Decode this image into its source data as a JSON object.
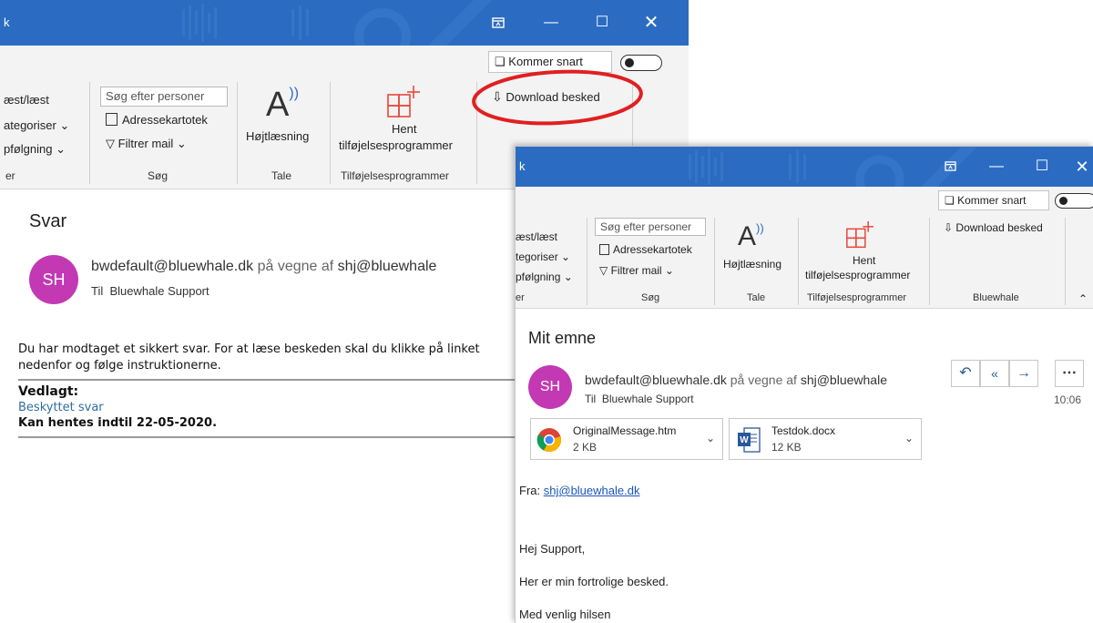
{
  "window1": {
    "title": "k",
    "coming_soon_label": "Kommer snart",
    "download_label": "Download besked",
    "ribbon": {
      "read_unread": "æst/læst",
      "categorize": "ategoriser",
      "followup": "pfølgning",
      "group_partial": "er",
      "search_placeholder": "Søg efter personer",
      "address_book": "Adressekartotek",
      "filter_mail": "Filtrer mail",
      "group_search": "Søg",
      "read_aloud": "Højtlæsning",
      "group_speech": "Tale",
      "get_addins_line1": "Hent",
      "get_addins_line2": "tilføjelsesprogrammer",
      "group_addins": "Tilføjelsesprogrammer"
    },
    "message": {
      "subject": "Svar",
      "avatar_initials": "SH",
      "sender": "bwdefault@bluewhale.dk",
      "on_behalf_word": "på vegne af",
      "on_behalf_of": "shj@bluewhale",
      "to_label": "Til",
      "to_value": "Bluewhale Support",
      "body_line1": "Du har modtaget et sikkert svar. For at læse beskeden skal du klikke på linket",
      "body_line2": "nedenfor og følge instruktionerne.",
      "attached_label": "Vedlagt:",
      "attached_link": "Beskyttet svar",
      "available_until": "Kan hentes indtil 22-05-2020."
    }
  },
  "window2": {
    "title": "k",
    "coming_soon_label": "Kommer snart",
    "download_label": "Download besked",
    "ribbon": {
      "read_unread": "æst/læst",
      "categorize": "tegoriser",
      "followup": "pfølgning",
      "group_partial": "er",
      "search_placeholder": "Søg efter personer",
      "address_book": "Adressekartotek",
      "filter_mail": "Filtrer mail",
      "group_search": "Søg",
      "read_aloud": "Højtlæsning",
      "group_speech": "Tale",
      "get_addins_line1": "Hent",
      "get_addins_line2": "tilføjelsesprogrammer",
      "group_addins": "Tilføjelsesprogrammer",
      "group_bluewhale": "Bluewhale"
    },
    "message": {
      "subject": "Mit emne",
      "avatar_initials": "SH",
      "sender": "bwdefault@bluewhale.dk",
      "on_behalf_word": "på vegne af",
      "on_behalf_of": "shj@bluewhale",
      "to_label": "Til",
      "to_value": "Bluewhale Support",
      "time": "10:06",
      "attachments": [
        {
          "name": "OriginalMessage.htm",
          "size": "2 KB"
        },
        {
          "name": "Testdok.docx",
          "size": "12 KB"
        }
      ],
      "from_label": "Fra:",
      "from_link": "shj@bluewhale.dk",
      "greeting": "Hej Support,",
      "line": "Her er min fortrolige besked.",
      "closing": "Med venlig hilsen"
    }
  },
  "colors": {
    "titlebar": "#2b6cc2",
    "avatar": "#c239b3",
    "annotation_ring": "#e02020",
    "accent_icon": "#e8493b"
  }
}
